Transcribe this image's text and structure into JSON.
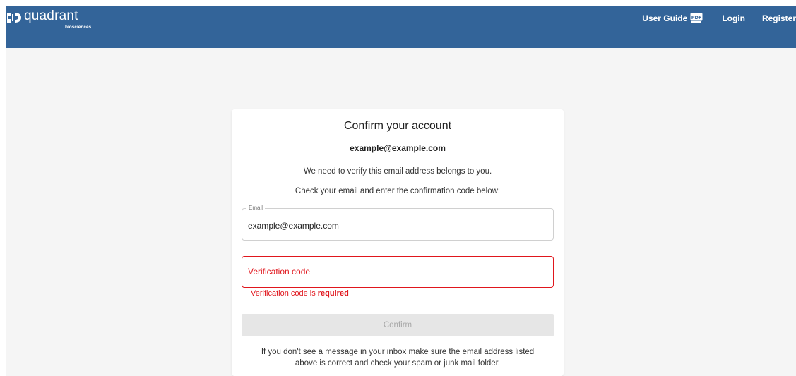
{
  "header": {
    "brand_name": "quadrant",
    "brand_sub": "biosciences",
    "nav": {
      "user_guide": "User Guide",
      "pdf_badge": "PDF",
      "login": "Login",
      "register": "Register"
    },
    "bar_color": "#336499"
  },
  "card": {
    "title": "Confirm your account",
    "email_display": "example@example.com",
    "info_line1": "We need to verify this email address belongs to you.",
    "info_line2": "Check your email and enter the confirmation code below:",
    "email_field": {
      "label": "Email",
      "value": "example@example.com"
    },
    "code_field": {
      "placeholder": "Verification code",
      "error_prefix": "Verification code is ",
      "error_emphasis": "required"
    },
    "confirm_label": "Confirm",
    "help_line1": "If you don't see a message in your inbox make sure the email address listed",
    "help_line2": "above is correct and check your spam or junk mail folder."
  },
  "colors": {
    "error": "#e0161d",
    "disabled_button": "#e6e6e6"
  },
  "icons": {
    "logo": "quadrant-logo-icon",
    "pdf": "pdf-icon"
  }
}
